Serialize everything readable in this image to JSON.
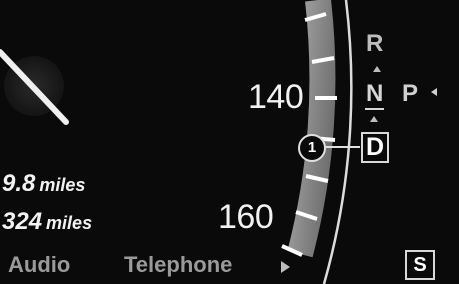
{
  "speedometer": {
    "scale_labels": [
      "140",
      "160"
    ]
  },
  "trip": {
    "line1_value": "9.8",
    "line1_unit": "miles",
    "line2_value": "324",
    "line2_unit": "miles"
  },
  "transmission": {
    "gears": [
      "R",
      "N",
      "D",
      "P"
    ],
    "selected": "D"
  },
  "callout": {
    "number": "1"
  },
  "menu": {
    "items": [
      "Audio",
      "Telephone"
    ],
    "next_icon": "right-triangle-icon"
  },
  "badge": {
    "label": "S"
  },
  "colors": {
    "background": "#0a0a0a",
    "text": "#f2f2f2",
    "dim_text": "#9a9a9a",
    "scale_band": "#8c8c8c"
  }
}
